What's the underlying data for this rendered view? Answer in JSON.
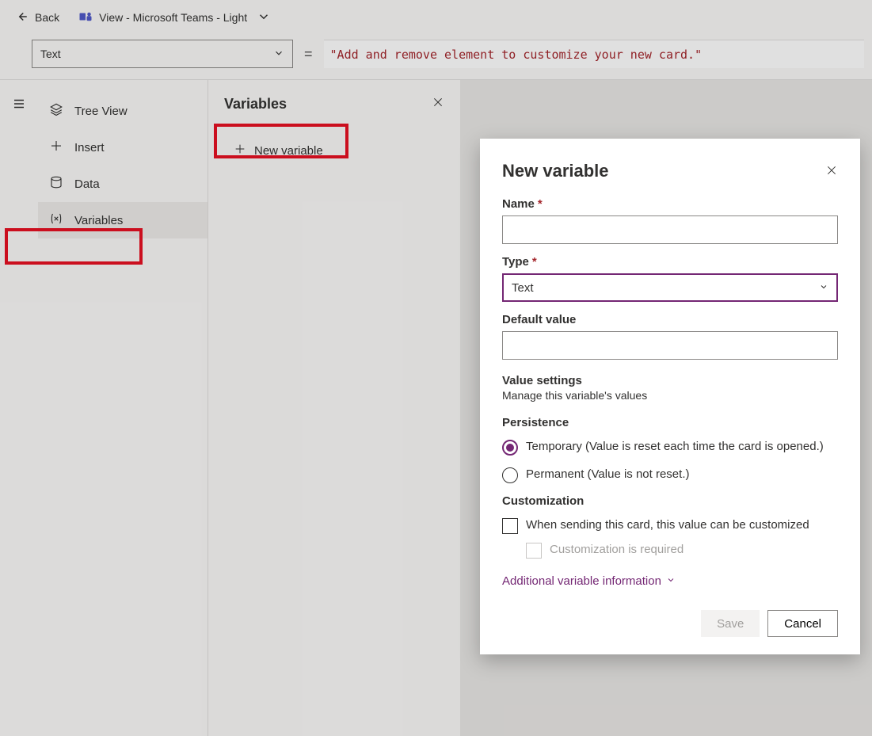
{
  "topbar": {
    "back_label": "Back",
    "app_label": "View - Microsoft Teams - Light"
  },
  "formula": {
    "property_selected": "Text",
    "equals": "=",
    "expression": "\"Add and remove element to customize your new card.\""
  },
  "nav": {
    "tree_view": "Tree View",
    "insert": "Insert",
    "data": "Data",
    "variables": "Variables"
  },
  "variables_panel": {
    "title": "Variables",
    "new_variable": "New variable"
  },
  "dialog": {
    "title": "New variable",
    "name_label": "Name",
    "type_label": "Type",
    "type_value": "Text",
    "default_label": "Default value",
    "value_settings_head": "Value settings",
    "value_settings_sub": "Manage this variable's values",
    "persistence_head": "Persistence",
    "radio_temp": "Temporary (Value is reset each time the card is opened.)",
    "radio_perm": "Permanent (Value is not reset.)",
    "customization_head": "Customization",
    "chk_customize": "When sending this card, this value can be customized",
    "chk_required": "Customization is required",
    "additional_link": "Additional variable information",
    "save_label": "Save",
    "cancel_label": "Cancel"
  }
}
